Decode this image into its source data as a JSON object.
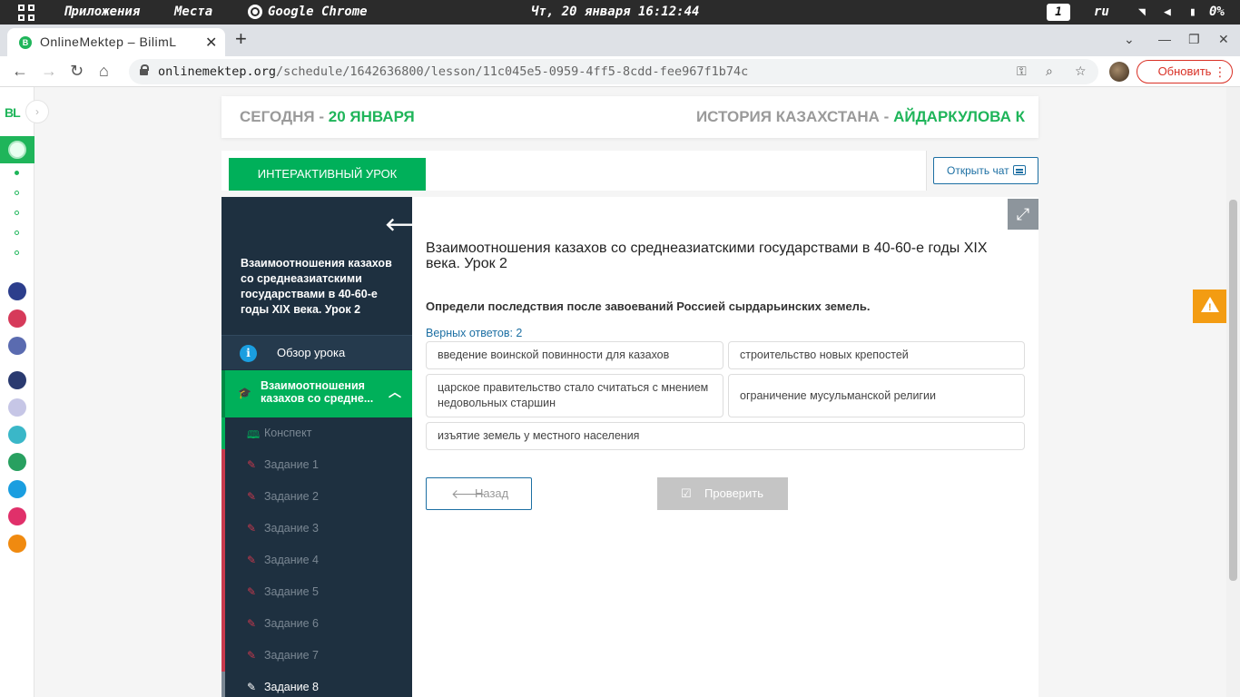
{
  "topbar": {
    "apps": "Приложения",
    "places": "Места",
    "browser": "Google Chrome",
    "clock": "Чт, 20 января 16:12:44",
    "workspace": "1",
    "lang": "ru",
    "battery": "0%"
  },
  "browser": {
    "tab_title": "OnlineMektep – BilimLand",
    "url_host": "onlinemektep.org",
    "url_path": "/schedule/1642636800/lesson/11c045e5-0959-4ff5-8cdd-fee967f1b74c",
    "update_label": "Обновить"
  },
  "rail": {
    "logo": "BL"
  },
  "header": {
    "today_label": "СЕГОДНЯ - ",
    "date": "20 ЯНВАРЯ",
    "subject": "ИСТОРИЯ КАЗАХСТАНА - ",
    "teacher": "АЙДАРКУЛОВА К"
  },
  "tabs": {
    "interactive": "ИНТЕРАКТИВНЫЙ УРОК",
    "open_chat": "Открыть чат"
  },
  "sidebar": {
    "title": "Взаимоотношения казахов со среднеазиатскими государствами в 40-60-е годы XIX века. Урок 2",
    "overview": "Обзор урока",
    "section": "Взаимоотношения казахов со средне...",
    "items": [
      {
        "label": "Конспект",
        "icon": "book-icon"
      },
      {
        "label": "Задание 1",
        "icon": "edit-icon"
      },
      {
        "label": "Задание 2",
        "icon": "edit-icon"
      },
      {
        "label": "Задание 3",
        "icon": "edit-icon"
      },
      {
        "label": "Задание 4",
        "icon": "edit-icon"
      },
      {
        "label": "Задание 5",
        "icon": "edit-icon"
      },
      {
        "label": "Задание 6",
        "icon": "edit-icon"
      },
      {
        "label": "Задание 7",
        "icon": "edit-icon"
      },
      {
        "label": "Задание 8",
        "icon": "edit-icon"
      }
    ]
  },
  "content": {
    "lesson_title": "Взаимоотношения казахов со среднеазиатскими государствами в 40-60-е годы XIX века. Урок 2",
    "question": "Определи последствия после завоеваний Россией сырдарьинских земель.",
    "correct_count": "Верных ответов: 2",
    "options": [
      "введение воинской повинности для казахов",
      "строительство новых крепостей",
      "царское правительство стало считаться с мнением недовольных старшин",
      "ограничение мусульманской религии",
      "изъятие земель у местного населения"
    ],
    "back_label": "Назад",
    "check_label": "Проверить"
  },
  "colors": {
    "accent_green": "#00b05a",
    "sidebar_bg": "#1e3040",
    "task_marker": "#c8394d",
    "link_blue": "#1c6fa3",
    "warning": "#f39c12"
  }
}
